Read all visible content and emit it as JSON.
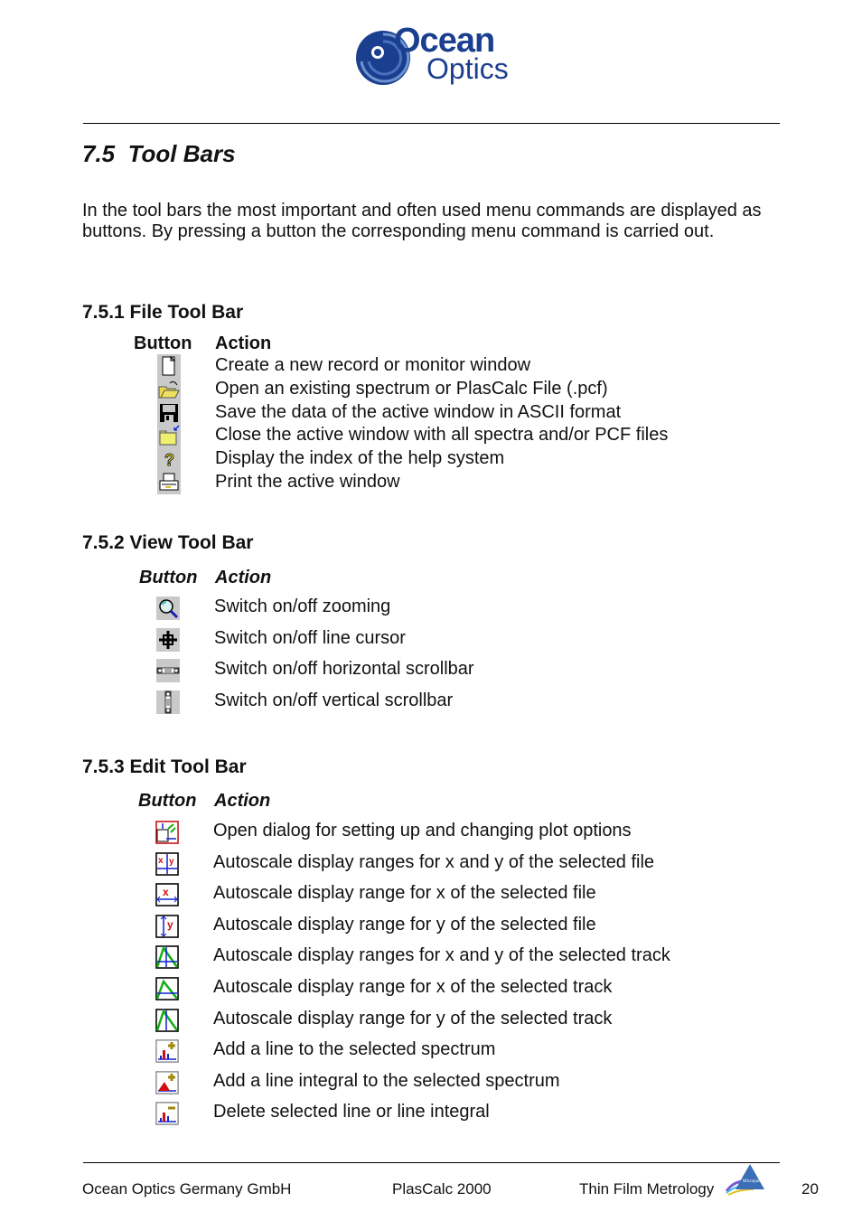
{
  "header": {
    "logo_text_top": "Ocean",
    "logo_text_bottom": "Optics"
  },
  "section": {
    "title": "7.5  Tool Bars",
    "intro": "In the tool bars the most important and often used menu commands are displayed as buttons. By pressing a button the corresponding menu command is carried out."
  },
  "file_toolbar": {
    "title": "7.5.1 File Tool Bar",
    "col_button": "Button",
    "col_action": "Action",
    "rows": [
      {
        "icon": "new-document-icon",
        "action": "Create a new record or monitor window"
      },
      {
        "icon": "open-folder-icon",
        "action": "Open an existing spectrum or PlasCalc File (.pcf)"
      },
      {
        "icon": "save-disk-icon",
        "action": "Save the data of the active window in ASCII format"
      },
      {
        "icon": "close-folder-icon",
        "action": "Close the active window with all spectra and/or PCF files"
      },
      {
        "icon": "help-question-icon",
        "action": "Display the index of the help system"
      },
      {
        "icon": "printer-icon",
        "action": "Print the active window"
      }
    ]
  },
  "view_toolbar": {
    "title": "7.5.2 View Tool Bar",
    "col_button": "Button",
    "col_action": "Action",
    "rows": [
      {
        "icon": "magnifier-icon",
        "action": "Switch on/off zooming"
      },
      {
        "icon": "crosshair-icon",
        "action": "Switch on/off line cursor"
      },
      {
        "icon": "horizontal-scrollbar-icon",
        "action": "Switch on/off horizontal scrollbar"
      },
      {
        "icon": "vertical-scrollbar-icon",
        "action": "Switch on/off vertical scrollbar"
      }
    ]
  },
  "edit_toolbar": {
    "title": "7.5.3 Edit Tool Bar",
    "col_button": "Button",
    "col_action": "Action",
    "rows": [
      {
        "icon": "plot-options-icon",
        "action": "Open dialog for setting up and changing plot options"
      },
      {
        "icon": "autoscale-xy-file-icon",
        "action": "Autoscale display ranges for x and y of the selected file"
      },
      {
        "icon": "autoscale-x-file-icon",
        "action": "Autoscale display range for x of the selected file"
      },
      {
        "icon": "autoscale-y-file-icon",
        "action": "Autoscale display range for y of the selected file"
      },
      {
        "icon": "autoscale-xy-track-icon",
        "action": "Autoscale display ranges for x and y of the selected track"
      },
      {
        "icon": "autoscale-x-track-icon",
        "action": "Autoscale display range for x of the selected track"
      },
      {
        "icon": "autoscale-y-track-icon",
        "action": "Autoscale display range for y of the selected track"
      },
      {
        "icon": "add-line-icon",
        "action": "Add a line to the selected spectrum"
      },
      {
        "icon": "add-line-integral-icon",
        "action": "Add a line integral to the selected spectrum"
      },
      {
        "icon": "delete-line-icon",
        "action": "Delete selected line or line integral"
      }
    ]
  },
  "footer": {
    "company": "Ocean Optics Germany GmbH",
    "product": "PlasCalc 2000",
    "topic": "Thin Film Metrology",
    "page": "20",
    "badge_text": "Micropack"
  },
  "colors": {
    "logo_blue": "#1b3f8f",
    "icon_bg": "#c9c9c9",
    "red": "#d01010",
    "blue": "#1020d0",
    "green": "#10b010"
  }
}
